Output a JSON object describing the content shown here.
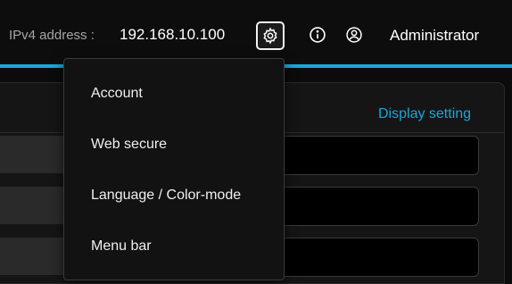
{
  "header": {
    "ipv4_label": "IPv4 address :",
    "ipv4_value": "192.168.10.100",
    "user_name": "Administrator",
    "accent_color": "#1aa6d9"
  },
  "icons": {
    "settings": "gear-icon",
    "info": "info-icon",
    "user": "user-icon"
  },
  "panel": {
    "display_setting_link": "Display setting"
  },
  "settings_menu": {
    "items": [
      {
        "label": "Account"
      },
      {
        "label": "Web secure"
      },
      {
        "label": "Language / Color-mode"
      },
      {
        "label": "Menu bar"
      }
    ]
  }
}
